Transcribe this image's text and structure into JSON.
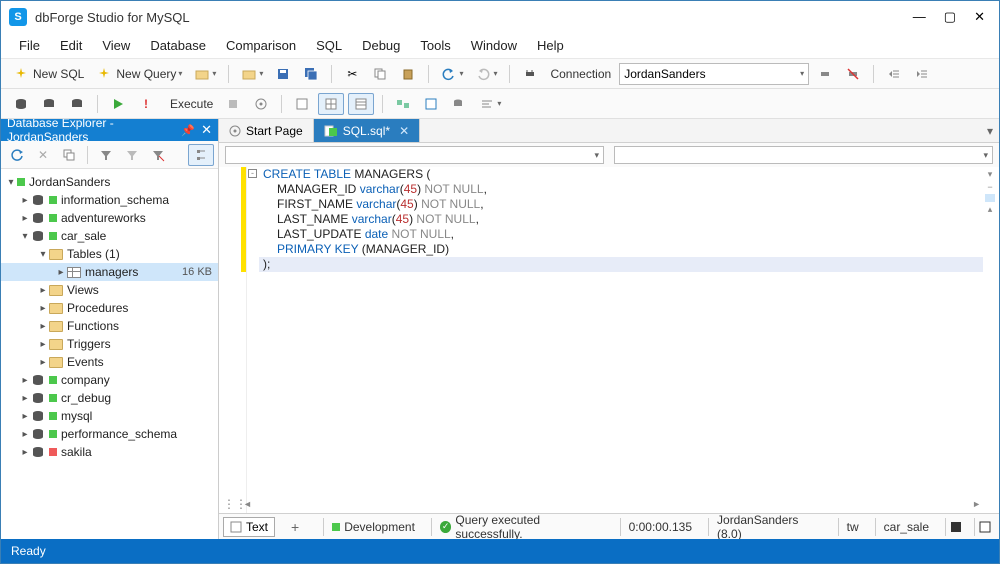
{
  "title": "dbForge Studio for MySQL",
  "menu": {
    "file": "File",
    "edit": "Edit",
    "view": "View",
    "database": "Database",
    "comparison": "Comparison",
    "sql": "SQL",
    "debug": "Debug",
    "tools": "Tools",
    "window": "Window",
    "help": "Help"
  },
  "toolbar": {
    "new_sql": "New SQL",
    "new_query": "New Query",
    "connection_label": "Connection",
    "connection_value": "JordanSanders",
    "execute_label": "Execute"
  },
  "sidebar": {
    "title": "Database Explorer - JordanSanders",
    "root": "JordanSanders",
    "databases": {
      "information_schema": "information_schema",
      "adventureworks": "adventureworks",
      "car_sale": "car_sale",
      "company": "company",
      "cr_debug": "cr_debug",
      "mysql": "mysql",
      "performance_schema": "performance_schema",
      "sakila": "sakila"
    },
    "folders": {
      "tables": "Tables (1)",
      "views": "Views",
      "procedures": "Procedures",
      "functions": "Functions",
      "triggers": "Triggers",
      "events": "Events"
    },
    "table_managers": "managers",
    "table_managers_size": "16 KB"
  },
  "tabs": {
    "start": "Start Page",
    "sql": "SQL.sql*"
  },
  "code": {
    "l1a": "CREATE",
    "l1b": "TABLE",
    "l1c": "MANAGERS",
    "l2a": "MANAGER_ID",
    "l2b": "varchar",
    "l2c": "45",
    "l2d": "NOT",
    "l2e": "NULL",
    "l3a": "FIRST_NAME",
    "l4a": "LAST_NAME",
    "l5a": "LAST_UPDATE",
    "l5b": "date",
    "l6a": "PRIMARY",
    "l6b": "KEY",
    "l6c": "MANAGER_ID"
  },
  "bottom": {
    "text_tab": "Text",
    "environment": "Development",
    "status_msg": "Query executed successfully.",
    "time": "0:00:00.135",
    "server": "JordanSanders (8.0)",
    "user": "tw",
    "database": "car_sale"
  },
  "statusbar": {
    "ready": "Ready"
  }
}
